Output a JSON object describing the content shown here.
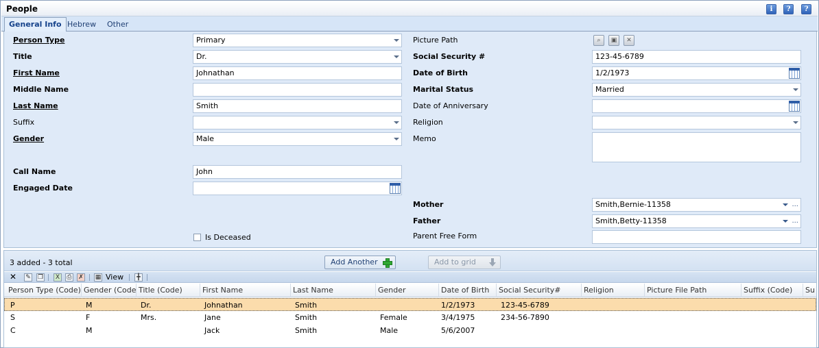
{
  "window": {
    "title": "People"
  },
  "header_icons": [
    "info-icon",
    "help-icon",
    "question-icon"
  ],
  "tabs": [
    {
      "label": "General Info",
      "active": true
    },
    {
      "label": "Hebrew",
      "active": false
    },
    {
      "label": "Other",
      "active": false
    }
  ],
  "form": {
    "person_type": {
      "label": "Person Type",
      "value": "Primary"
    },
    "title": {
      "label": "Title",
      "value": "Dr."
    },
    "first_name": {
      "label": "First Name",
      "value": "Johnathan"
    },
    "middle_name": {
      "label": "Middle Name",
      "value": ""
    },
    "last_name": {
      "label": "Last Name",
      "value": "Smith"
    },
    "suffix": {
      "label": "Suffix",
      "value": ""
    },
    "gender": {
      "label": "Gender",
      "value": "Male"
    },
    "call_name": {
      "label": "Call Name",
      "value": "John"
    },
    "engaged_date": {
      "label": "Engaged Date",
      "value": ""
    },
    "is_deceased": {
      "label": "Is Deceased",
      "checked": false
    },
    "picture_path": {
      "label": "Picture Path"
    },
    "ssn": {
      "label": "Social Security #",
      "value": "123-45-6789"
    },
    "dob": {
      "label": "Date of Birth",
      "value": "1/2/1973"
    },
    "marital_status": {
      "label": "Marital Status",
      "value": "Married"
    },
    "anniversary": {
      "label": "Date of Anniversary",
      "value": ""
    },
    "religion": {
      "label": "Religion",
      "value": ""
    },
    "memo": {
      "label": "Memo",
      "value": ""
    },
    "mother": {
      "label": "Mother",
      "value": "Smith,Bernie-11358"
    },
    "father": {
      "label": "Father",
      "value": "Smith,Betty-11358"
    },
    "parent_free_form": {
      "label": "Parent Free Form",
      "value": ""
    }
  },
  "grid_panel": {
    "summary": "3 added - 3 total",
    "add_another_label": "Add Another",
    "add_to_grid_label": "Add to grid",
    "view_label": "View",
    "columns": [
      "Person Type (Code)",
      "Gender (Code)",
      "Title  (Code)",
      "First Name",
      "Last Name",
      "Gender",
      "Date of Birth",
      "Social Security#",
      "Religion",
      "Picture File Path",
      "Suffix (Code)",
      "Su"
    ],
    "rows": [
      {
        "selected": true,
        "cells": [
          "P",
          "M",
          "Dr.",
          "Johnathan",
          "Smith",
          "",
          "1/2/1973",
          "123-45-6789",
          "",
          "",
          "",
          ""
        ]
      },
      {
        "selected": false,
        "cells": [
          "S",
          "F",
          "Mrs.",
          "Jane",
          "Smith",
          "Female",
          "3/4/1975",
          "234-56-7890",
          "",
          "",
          "",
          ""
        ]
      },
      {
        "selected": false,
        "cells": [
          "C",
          "M",
          "",
          "Jack",
          "Smith",
          "Male",
          "5/6/2007",
          "",
          "",
          "",
          "",
          ""
        ]
      }
    ]
  }
}
